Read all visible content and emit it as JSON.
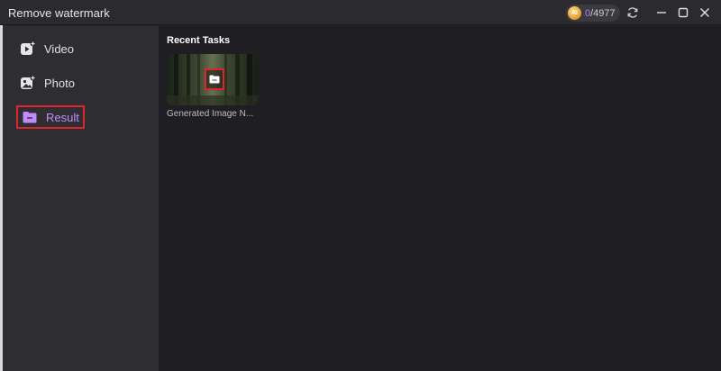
{
  "window": {
    "title": "Remove watermark",
    "credits": {
      "used": "0",
      "total": "/4977",
      "coin_text": "AI"
    }
  },
  "sidebar": {
    "items": [
      {
        "label": "Video",
        "icon": "video-add-icon",
        "active": false
      },
      {
        "label": "Photo",
        "icon": "photo-add-icon",
        "active": false
      },
      {
        "label": "Result",
        "icon": "folder-icon",
        "active": true
      }
    ]
  },
  "main": {
    "section_title": "Recent Tasks",
    "tasks": [
      {
        "name": "Generated Image N..."
      }
    ]
  },
  "colors": {
    "accent": "#c18bff",
    "highlight_border": "#e0242b",
    "sidebar_bg": "#2e2e32",
    "main_bg": "#1f1f23"
  }
}
